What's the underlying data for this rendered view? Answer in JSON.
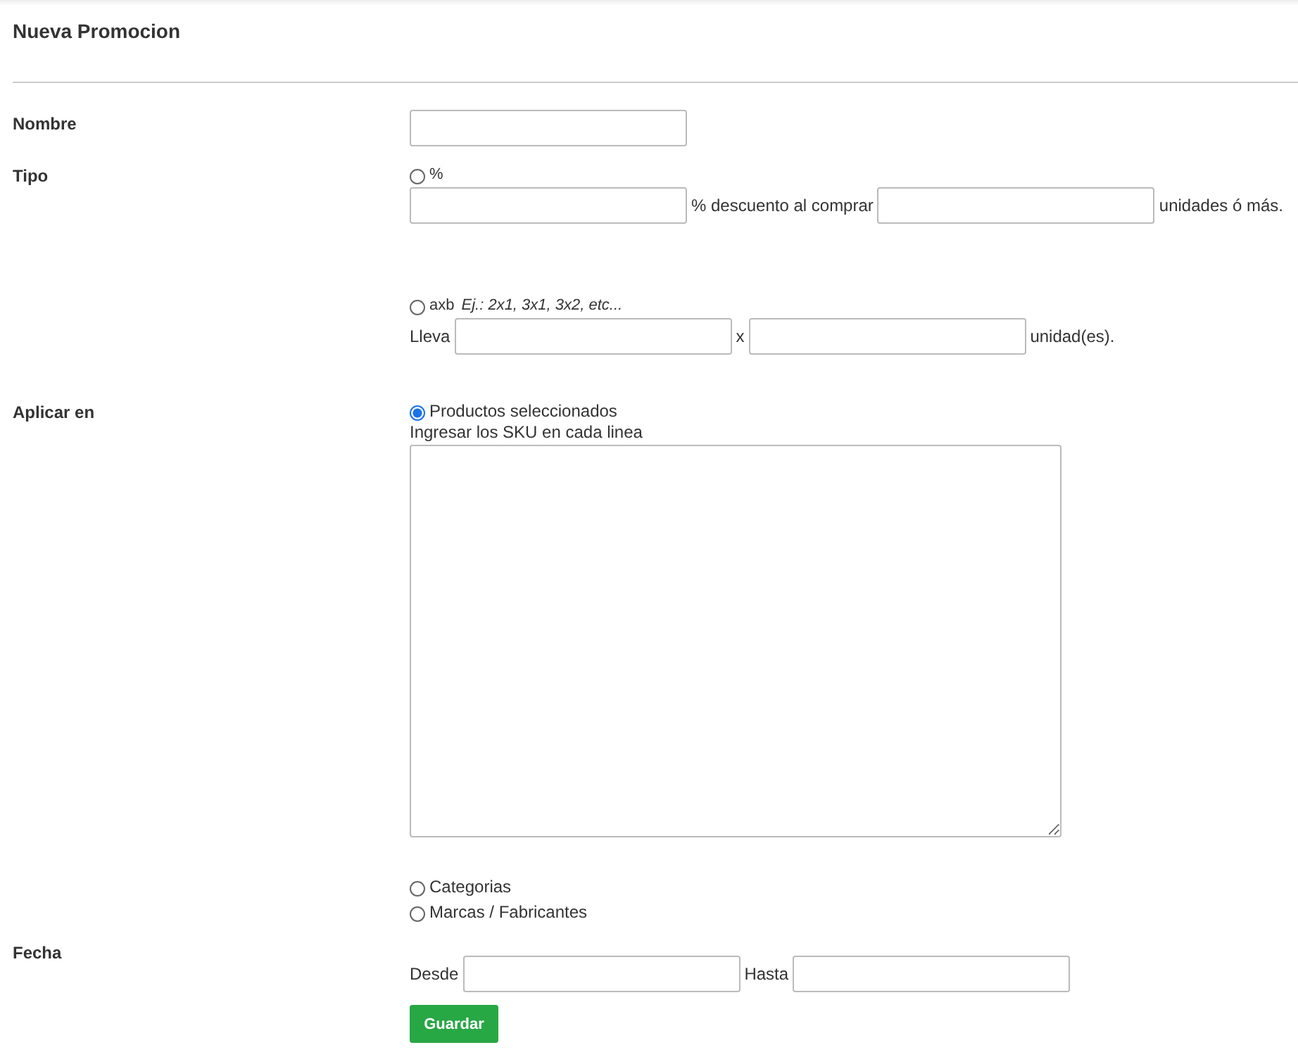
{
  "title": "Nueva Promocion",
  "nombre": {
    "label": "Nombre"
  },
  "tipo": {
    "label": "Tipo",
    "options": [
      {
        "kind": "percent",
        "label": "%",
        "selected": false,
        "text_1": "% descuento al comprar",
        "text_2": "unidades ó más."
      },
      {
        "kind": "axb",
        "label": "axb",
        "hint": "Ej.: 2x1, 3x1, 3x2, etc...",
        "selected": false,
        "prefix": "Lleva",
        "text_1": "x",
        "text_2": "unidad(es)."
      }
    ]
  },
  "aplicar": {
    "label": "Aplicar en",
    "options": [
      {
        "kind": "sku",
        "label": "Productos seleccionados",
        "selected": true,
        "note": "Ingresar los SKU en cada linea"
      },
      {
        "kind": "plain",
        "label": "Categorias",
        "selected": false
      },
      {
        "kind": "plain",
        "label": "Marcas / Fabricantes",
        "selected": false
      }
    ]
  },
  "fecha": {
    "label": "Fecha",
    "from": "Desde",
    "to": "Hasta"
  },
  "save_button": "Guardar"
}
